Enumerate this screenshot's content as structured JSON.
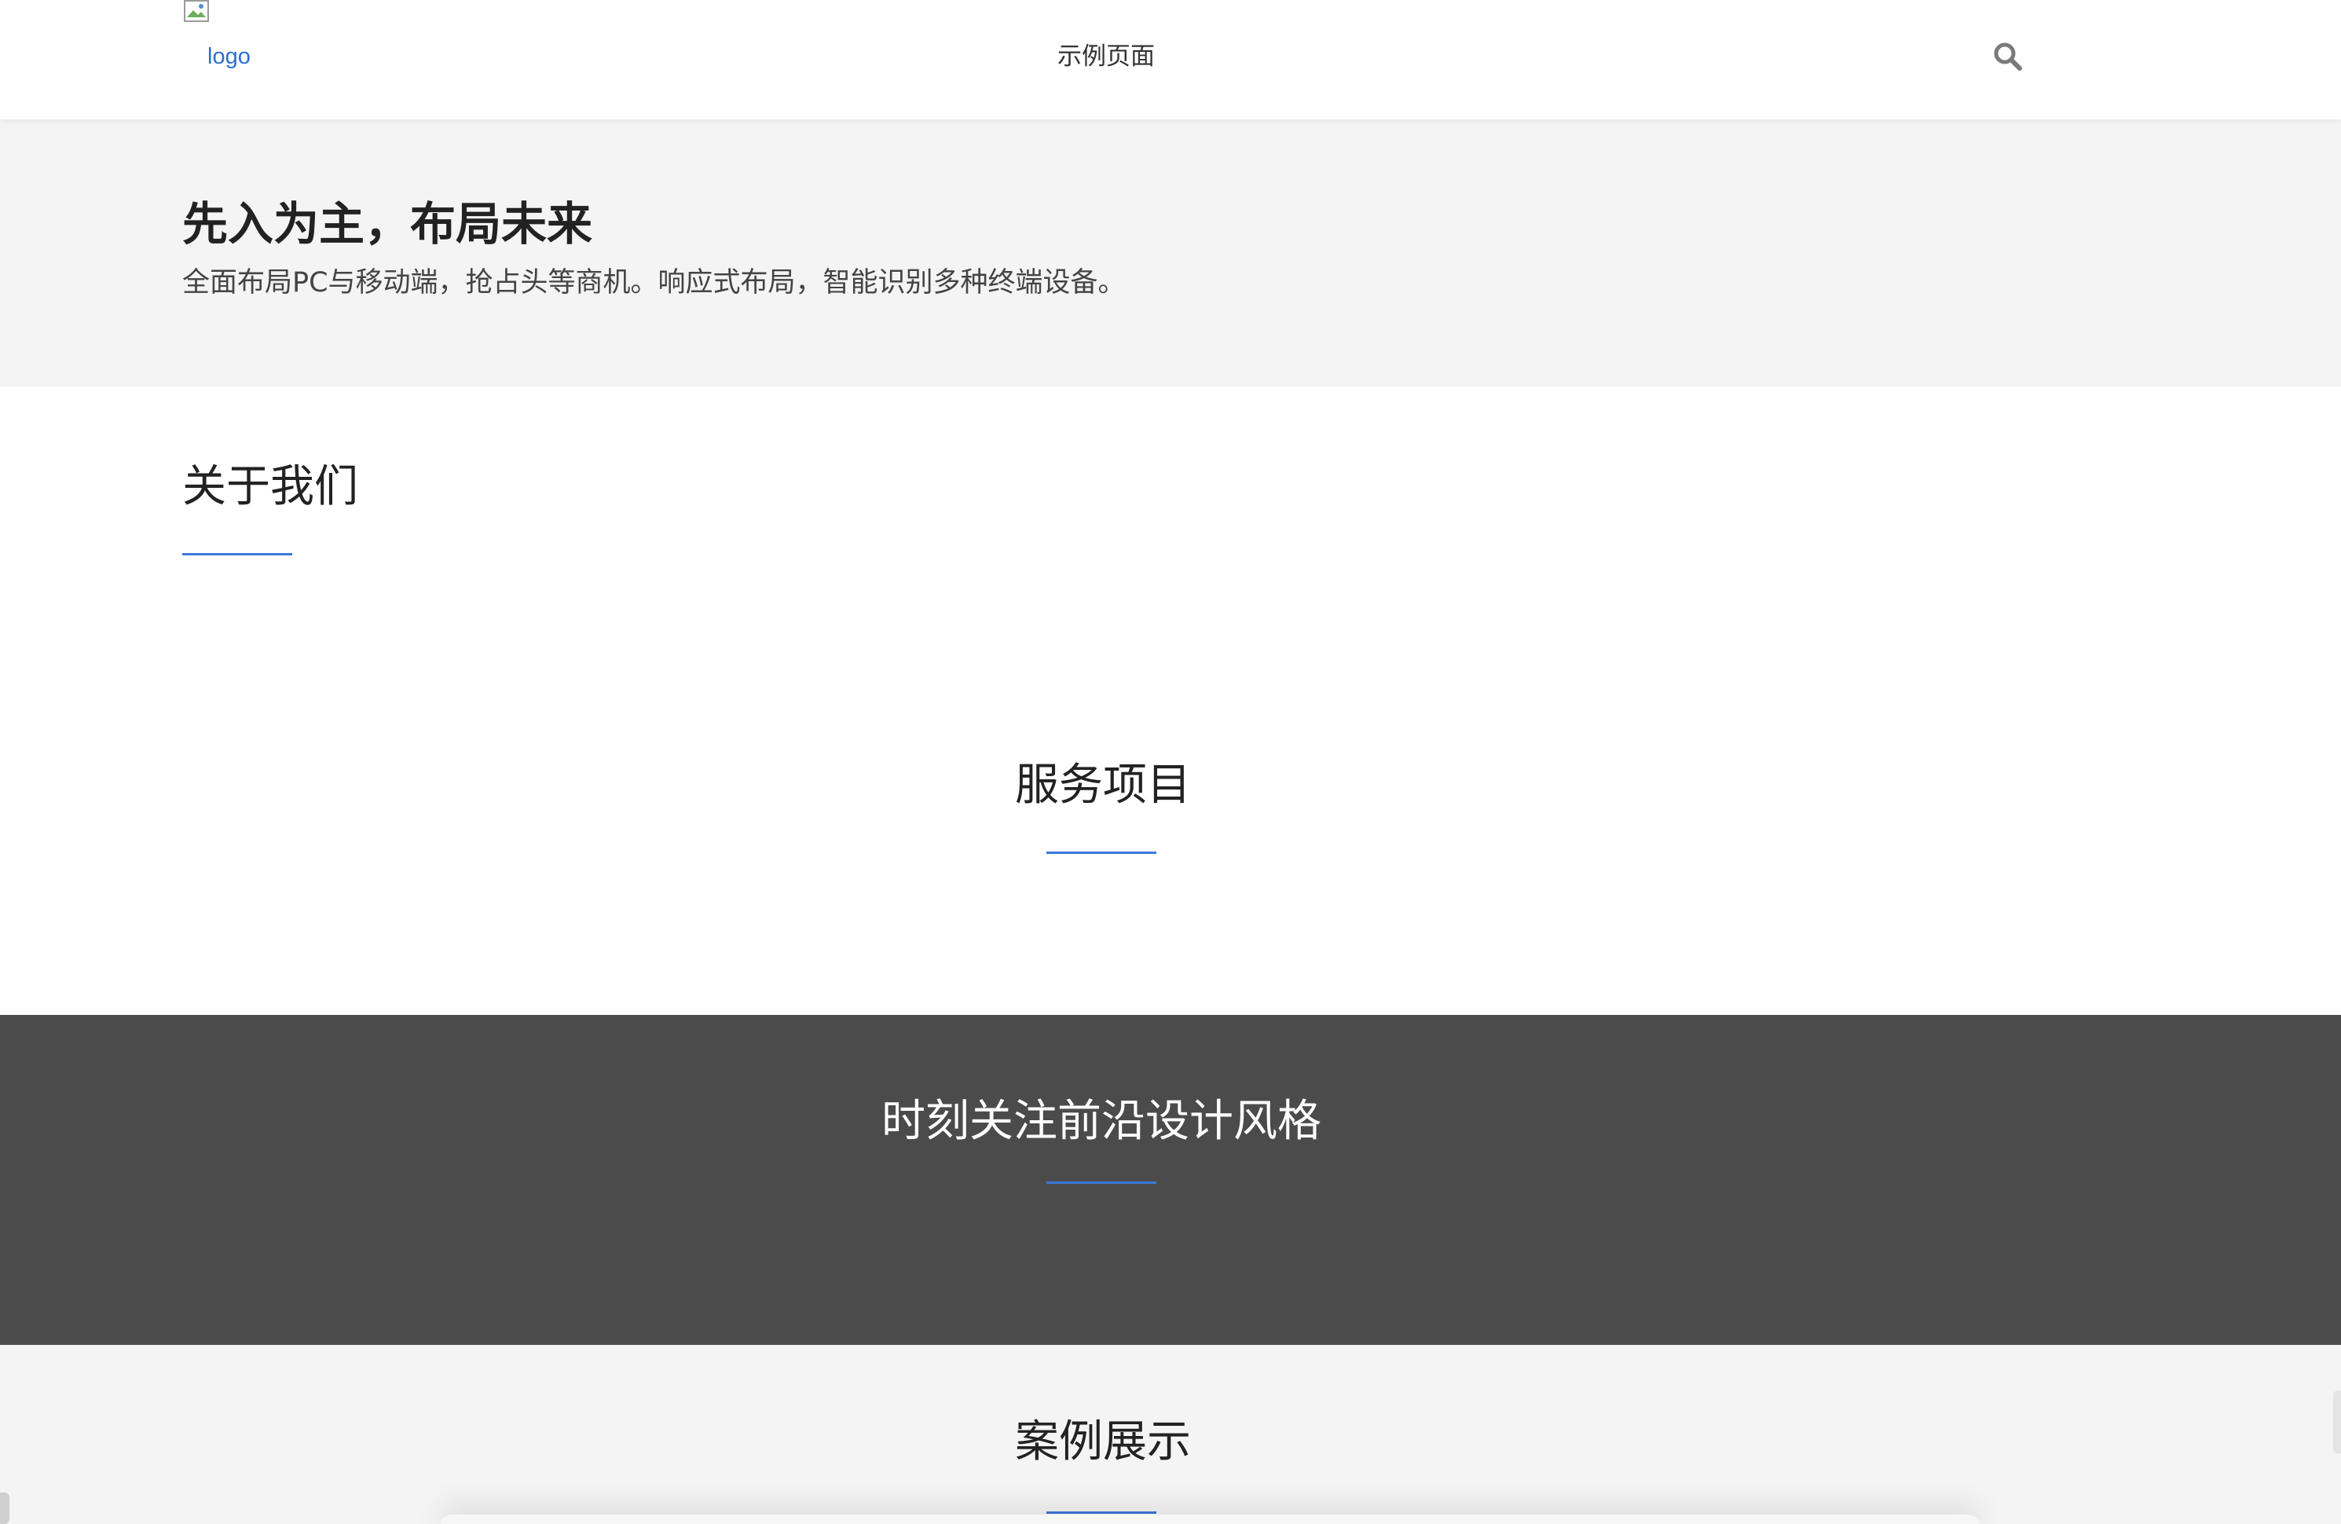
{
  "header": {
    "logo_alt": "logo",
    "nav_title": "示例页面",
    "search_icon": "search-icon"
  },
  "hero": {
    "title": "先入为主，布局未来",
    "subtitle": "全面布局PC与移动端，抢占头等商机。响应式布局，智能识别多种终端设备。"
  },
  "sections": {
    "about": "关于我们",
    "services": "服务项目",
    "trend": "时刻关注前沿设计风格",
    "cases": "案例展示"
  },
  "colors": {
    "accent": "#3c78d8",
    "dark_band": "#4b4b4b",
    "light_band": "#f4f4f4",
    "link": "#2a6fd1"
  }
}
